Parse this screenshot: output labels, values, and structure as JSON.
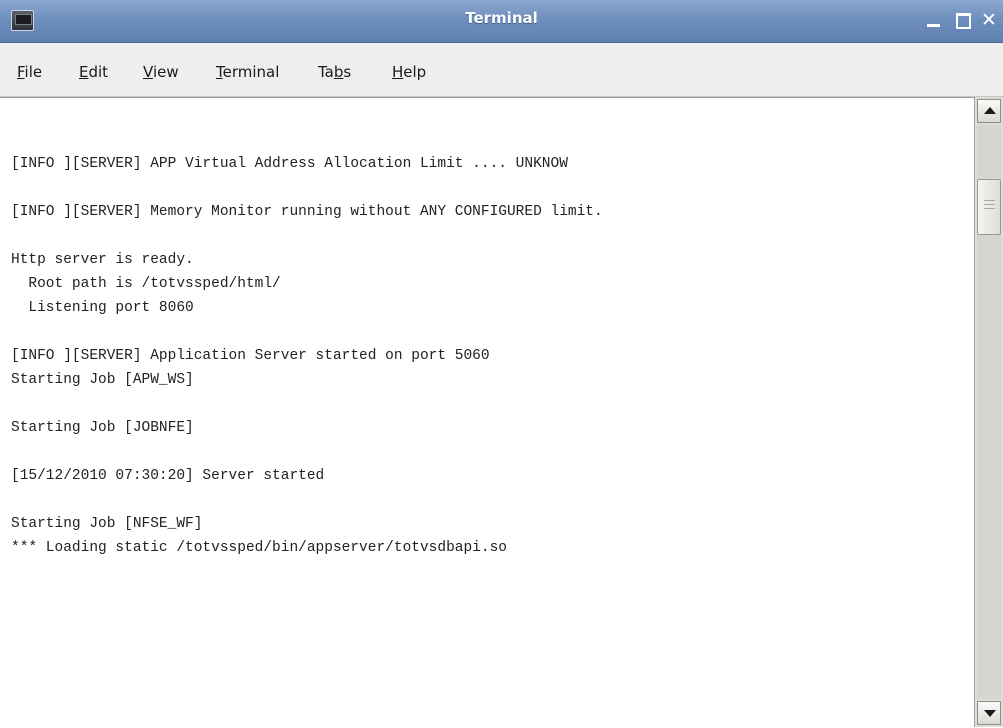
{
  "window": {
    "title": "Terminal",
    "buttons": {
      "minimize_icon": "minimize-icon",
      "maximize_icon": "maximize-icon",
      "close_icon": "close-icon",
      "close_glyph": "✕"
    }
  },
  "menu": {
    "items": [
      {
        "label_pre": "",
        "label_u": "F",
        "label_post": "ile"
      },
      {
        "label_pre": "",
        "label_u": "E",
        "label_post": "dit"
      },
      {
        "label_pre": "",
        "label_u": "V",
        "label_post": "iew"
      },
      {
        "label_pre": "",
        "label_u": "T",
        "label_post": "erminal"
      },
      {
        "label_pre": "Ta",
        "label_u": "b",
        "label_post": "s"
      },
      {
        "label_pre": "",
        "label_u": "H",
        "label_post": "elp"
      }
    ]
  },
  "terminal": {
    "lines": [
      "[INFO ][SERVER] APP Virtual Address Allocation Limit .... UNKNOW",
      "[INFO ][SERVER] Memory Monitor running without ANY CONFIGURED limit.",
      "Http server is ready.",
      "  Root path is /totvssped/html/",
      "  Listening port 8060",
      "[INFO ][SERVER] Application Server started on port 5060",
      "Starting Job [APW_WS]",
      "Starting Job [JOBNFE]",
      "[15/12/2010 07:30:20] Server started",
      "Starting Job [NFSE_WF]",
      "*** Loading static /totvssped/bin/appserver/totvsdbapi.so"
    ]
  },
  "scrollbar": {
    "position_fraction": 0.12
  }
}
